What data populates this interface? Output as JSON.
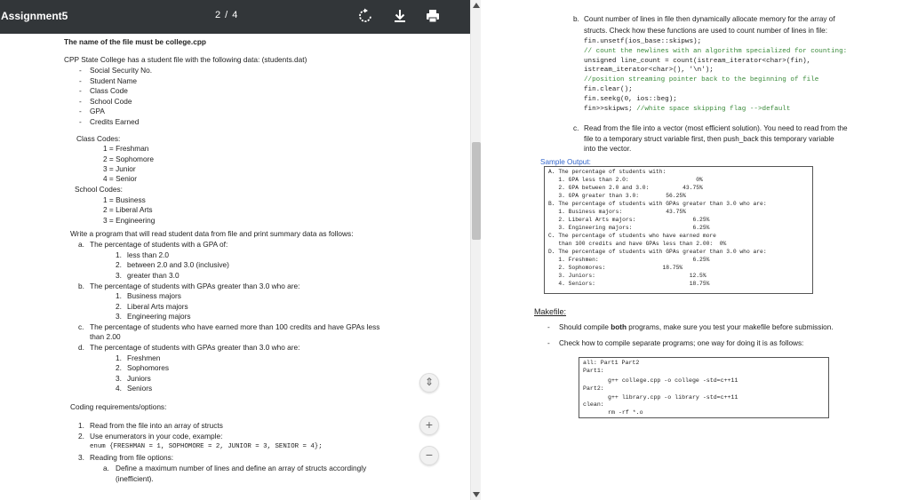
{
  "toolbar": {
    "title": "Assignment5",
    "page_indicator": "2 / 4",
    "icons": [
      "rotate-icon",
      "download-icon",
      "print-icon"
    ]
  },
  "left_page": {
    "file_note": "The name of the file must be college.cpp",
    "intro": "CPP State College has a student file with the following data: (students.dat)",
    "fields": [
      "Social Security No.",
      "Student Name",
      "Class Code",
      "School Code",
      "GPA",
      "Credits Earned"
    ],
    "class_codes_label": "Class Codes:",
    "class_codes": [
      "1 = Freshman",
      "2 = Sophomore",
      "3 = Junior",
      "4 = Senior"
    ],
    "school_codes_label": "School Codes:",
    "school_codes": [
      "1 = Business",
      "2 = Liberal Arts",
      "3 = Engineering"
    ],
    "program_intro": "Write a program that will read student data from file and print summary data as follows:",
    "item_a": "The percentage of students with a GPA of:",
    "item_a_subs": [
      "less than 2.0",
      "between 2.0 and 3.0 (inclusive)",
      "greater than 3.0"
    ],
    "item_b": "The percentage of students with GPAs greater than 3.0 who are:",
    "item_b_subs": [
      "Business majors",
      "Liberal Arts majors",
      "Engineering majors"
    ],
    "item_c_line1": "The percentage of students who have earned more than 100 credits and have GPAs less",
    "item_c_line2": "than 2.00",
    "item_d": "The percentage of students with GPAs greater than 3.0 who are:",
    "item_d_subs": [
      "Freshmen",
      "Sophomores",
      "Juniors",
      "Seniors"
    ],
    "coding_label": "Coding requirements/options:",
    "req1": "Read from the file into an array of structs",
    "req2": "Use enumerators in your code, example:",
    "enum_example": "enum {FRESHMAN = 1, SOPHOMORE = 2, JUNIOR = 3, SENIOR = 4};",
    "req3": "Reading from file options:",
    "req3a_line1": "Define a maximum number of lines and define an array of structs accordingly",
    "req3a_line2": "(inefficient)."
  },
  "right_page": {
    "b_line1": "Count number of lines in file then dynamically allocate memory for the array of",
    "b_line2": "structs. Check how these functions are used to count number of lines in file:",
    "code_lines": [
      "fin.unsetf(ios_base::skipws);",
      "// count the newlines with an algorithm specialized for counting:",
      "unsigned line_count = count(istream_iterator<char>(fin),",
      "istream_iterator<char>(), '\\n');",
      "//position streaming pointer back to the beginning of file",
      "fin.clear();",
      "fin.seekg(0, ios::beg);"
    ],
    "code_last": "fin>>skipws;",
    "code_last_comment": " //white space skipping flag -->default",
    "c_line1": "Read from the file into a vector (most efficient solution). You need to read from the",
    "c_line2": "file to a temporary struct variable first, then push_back this temporary variable",
    "c_line3": "into the vector.",
    "sample_label": "Sample Output:",
    "sample_lines": [
      "A. The percentage of students with:",
      "   1. GPA less than 2.0:                    0%",
      "   2. GPA between 2.0 and 3.0:          43.75%",
      "   3. GPA greater than 3.0:        56.25%",
      "B. The percentage of students with GPAs greater than 3.0 who are:",
      "   1. Business majors:             43.75%",
      "   2. Liberal Arts majors:                 6.25%",
      "   3. Engineering majors:                  6.25%",
      "C. The percentage of students who have earned more",
      "   than 100 credits and have GPAs less than 2.00:  0%",
      "D. The percentage of students with GPAs greater than 3.0 who are:",
      "   1. Freshmen:                            6.25%",
      "   2. Sophomores:                 18.75%",
      "   3. Juniors:                            12.5%",
      "   4. Seniors:                            18.75%"
    ],
    "makefile_heading": "Makefile:",
    "mk_bullet1_pre": "Should compile ",
    "mk_bullet1_bold": "both",
    "mk_bullet1_post": " programs, make sure you test your makefile before submission.",
    "mk_bullet2": "Check how to compile separate programs; one way for doing it is as follows:",
    "makefile_lines": [
      "all: Part1 Part2",
      "Part1:",
      "g++ college.cpp -o college -std=c++11",
      "Part2:",
      "g++ library.cpp -o library -std=c++11",
      "clean:",
      "rm -rf *.o"
    ]
  },
  "zoom": {
    "fit": "⇕",
    "plus": "+",
    "minus": "−"
  },
  "colors": {
    "toolbar": "#323639",
    "comment": "#3a8a3a",
    "sample_label": "#3366cc"
  }
}
